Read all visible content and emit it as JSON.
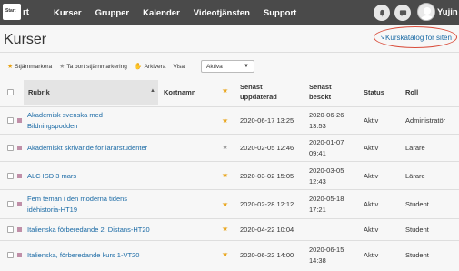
{
  "topnav": {
    "logo_text": "Start",
    "partial_text": "rt",
    "items": [
      "Kurser",
      "Grupper",
      "Kalender",
      "Videotjänsten",
      "Support"
    ],
    "user_name": "Yujin",
    "icons": [
      "bell-icon",
      "chat-icon",
      "avatar"
    ]
  },
  "page": {
    "title": "Kurser",
    "catalog_link": "Kurskatalog för siten"
  },
  "toolbar": {
    "star_mark": "Stjärnmarkera",
    "remove_star": "Ta bort stjärnmarkering",
    "archive": "Arkivera",
    "show_label": "Visa",
    "filter_value": "Aktiva"
  },
  "table": {
    "headers": {
      "rubrik": "Rubrik",
      "kortnamn": "Kortnamn",
      "updated": [
        "Senast",
        "uppdaterad"
      ],
      "visited": [
        "Senast",
        "besökt"
      ],
      "status": "Status",
      "roll": "Roll"
    },
    "rows": [
      {
        "name": [
          "Akademisk svenska med",
          "Bildningspodden"
        ],
        "starred": true,
        "updated": "2020-06-17 13:25",
        "visited": [
          "2020-06-26",
          "13:53"
        ],
        "status": "Aktiv",
        "role": "Administratör"
      },
      {
        "name": [
          "Akademiskt skrivande för lärarstudenter"
        ],
        "starred": false,
        "updated": "2020-02-05 12:46",
        "visited": [
          "2020-01-07",
          "09:41"
        ],
        "status": "Aktiv",
        "role": "Lärare"
      },
      {
        "name": [
          "ALC ISD 3 mars"
        ],
        "starred": true,
        "updated": "2020-03-02 15:05",
        "visited": [
          "2020-03-05",
          "12:43"
        ],
        "status": "Aktiv",
        "role": "Lärare"
      },
      {
        "name": [
          "Fem teman i den moderna tidens",
          "idéhistoria-HT19"
        ],
        "starred": true,
        "updated": "2020-02-28 12:12",
        "visited": [
          "2020-05-18",
          "17:21"
        ],
        "status": "Aktiv",
        "role": "Student"
      },
      {
        "name": [
          "Italienska förberedande 2, Distans-HT20"
        ],
        "starred": true,
        "updated": "2020-04-22 10:04",
        "visited": [],
        "status": "Aktiv",
        "role": "Student"
      },
      {
        "name": [
          "Italienska, förberedande kurs 1-VT20"
        ],
        "starred": true,
        "updated": "2020-06-22 14:00",
        "visited": [
          "2020-06-15",
          "14:38"
        ],
        "status": "Aktiv",
        "role": "Student"
      }
    ]
  },
  "colors": {
    "nav_bg": "#4a4a4a",
    "link": "#1a6aa5",
    "star_on": "#e8a316",
    "annotation": "#d94c3a"
  }
}
